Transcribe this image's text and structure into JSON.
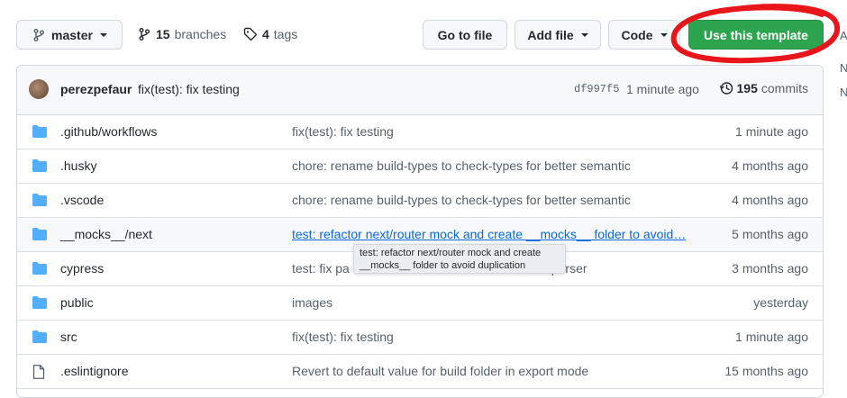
{
  "toolbar": {
    "branch_label": "master",
    "branches_count": "15",
    "branches_label": "branches",
    "tags_count": "4",
    "tags_label": "tags",
    "go_to_file": "Go to file",
    "add_file": "Add file",
    "code": "Code",
    "use_template": "Use this template"
  },
  "commit": {
    "author": "perezpefaur",
    "message": "fix(test): fix testing",
    "hash": "df997f5",
    "time": "1 minute ago",
    "count": "195",
    "count_label": "commits"
  },
  "files": [
    {
      "name": ".github/workflows",
      "type": "folder",
      "message": "fix(test): fix testing",
      "age": "1 minute ago"
    },
    {
      "name": ".husky",
      "type": "folder",
      "message": "chore: rename build-types to check-types for better semantic",
      "age": "4 months ago"
    },
    {
      "name": ".vscode",
      "type": "folder",
      "message": "chore: rename build-types to check-types for better semantic",
      "age": "4 months ago"
    },
    {
      "name": "__mocks__/next",
      "type": "folder",
      "message": "test: refactor next/router mock and create __mocks__ folder to avoid…",
      "age": "5 months ago"
    },
    {
      "name": "cypress",
      "type": "folder",
      "message": "test: fix pa                                               -eslint parser",
      "age": "3 months ago"
    },
    {
      "name": "public",
      "type": "folder",
      "message": "images",
      "age": "yesterday"
    },
    {
      "name": "src",
      "type": "folder",
      "message": "fix(test): fix testing",
      "age": "1 minute ago"
    },
    {
      "name": ".eslintignore",
      "type": "file",
      "message": "Revert to default value for build folder in export mode",
      "age": "15 months ago"
    }
  ],
  "tooltip": {
    "line1": "test: refactor next/router mock and create",
    "line2": "__mocks__ folder to avoid duplication"
  },
  "colors": {
    "primary_green": "#2da44e",
    "folder_blue": "#54aeff",
    "link_blue": "#0969da",
    "annotation_red": "#e8161a"
  }
}
